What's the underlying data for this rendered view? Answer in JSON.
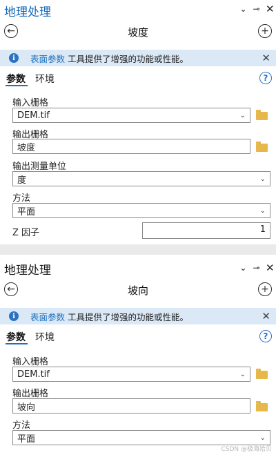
{
  "pane1": {
    "title": "地理处理",
    "tool_name": "坡度",
    "banner": {
      "link": "表面参数",
      "text": " 工具提供了增强的功能或性能。"
    },
    "tabs": [
      "参数",
      "环境"
    ],
    "fields": {
      "input_raster": {
        "label": "输入栅格",
        "value": "DEM.tif"
      },
      "output_raster": {
        "label": "输出栅格",
        "value": "坡度"
      },
      "unit": {
        "label": "输出测量单位",
        "value": "度"
      },
      "method": {
        "label": "方法",
        "value": "平面"
      },
      "z_factor": {
        "label": "Z 因子",
        "value": "1"
      }
    }
  },
  "pane2": {
    "title": "地理处理",
    "tool_name": "坡向",
    "banner": {
      "link": "表面参数",
      "text": " 工具提供了增强的功能或性能。"
    },
    "tabs": [
      "参数",
      "环境"
    ],
    "fields": {
      "input_raster": {
        "label": "输入栅格",
        "value": "DEM.tif"
      },
      "output_raster": {
        "label": "输出栅格",
        "value": "坡向"
      },
      "method": {
        "label": "方法",
        "value": "平面"
      }
    }
  },
  "icons": {
    "back": "←",
    "add": "+",
    "info": "i",
    "close": "✕",
    "chevron": "⌄",
    "pin": "⊸",
    "help": "?"
  },
  "watermark": "CSDN @极海拾贝",
  "colors": {
    "accent": "#1d6fbd",
    "banner_bg": "#dbe9f7",
    "folder": "#e6b84a"
  }
}
